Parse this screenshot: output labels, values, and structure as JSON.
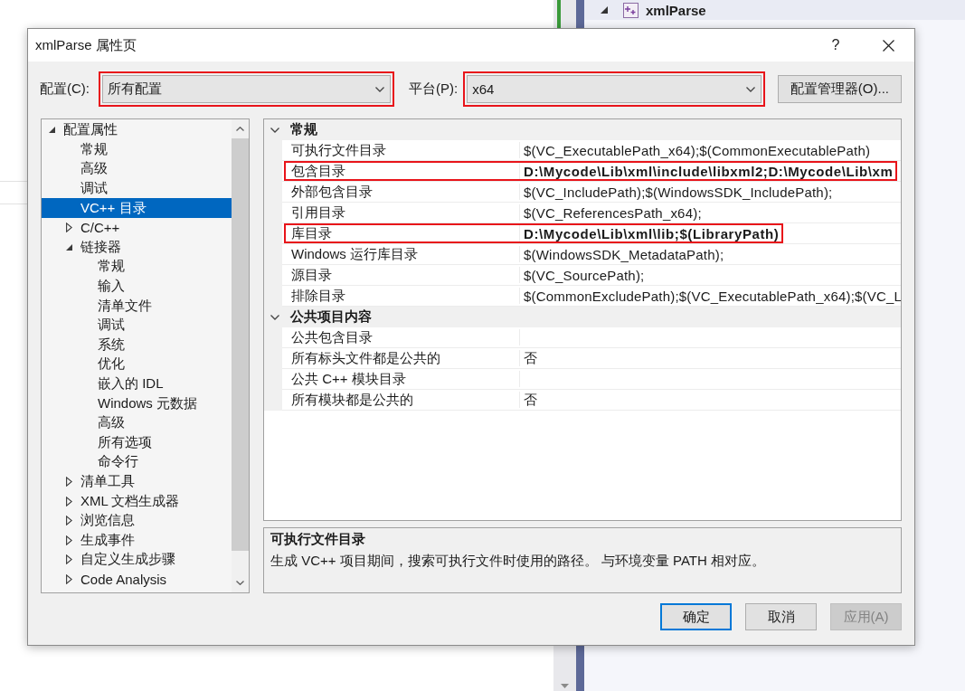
{
  "background": {
    "solution_explorer": {
      "items": [
        {
          "label": "xmlParse",
          "expanded": true
        }
      ]
    }
  },
  "dialog": {
    "title": "xmlParse 属性页",
    "help_button": "?"
  },
  "config_bar": {
    "configuration": {
      "label": "配置(C):",
      "value": "所有配置",
      "highlighted": true
    },
    "platform": {
      "label": "平台(P):",
      "value": "x64",
      "highlighted": true
    },
    "manager_button": "配置管理器(O)..."
  },
  "tree": [
    {
      "label": "配置属性",
      "kind": "group",
      "expanded": true,
      "selected": false,
      "children": [
        {
          "label": "常规",
          "kind": "page",
          "selected": false
        },
        {
          "label": "高级",
          "kind": "page",
          "selected": false
        },
        {
          "label": "调试",
          "kind": "page",
          "selected": false
        },
        {
          "label": "VC++ 目录",
          "kind": "page",
          "selected": true
        },
        {
          "label": "C/C++",
          "kind": "group",
          "expanded": false,
          "selected": false
        },
        {
          "label": "链接器",
          "kind": "group",
          "expanded": true,
          "selected": false,
          "children": [
            {
              "label": "常规",
              "kind": "page",
              "selected": false
            },
            {
              "label": "输入",
              "kind": "page",
              "selected": false
            },
            {
              "label": "清单文件",
              "kind": "page",
              "selected": false
            },
            {
              "label": "调试",
              "kind": "page",
              "selected": false
            },
            {
              "label": "系统",
              "kind": "page",
              "selected": false
            },
            {
              "label": "优化",
              "kind": "page",
              "selected": false
            },
            {
              "label": "嵌入的 IDL",
              "kind": "page",
              "selected": false
            },
            {
              "label": "Windows 元数据",
              "kind": "page",
              "selected": false
            },
            {
              "label": "高级",
              "kind": "page",
              "selected": false
            },
            {
              "label": "所有选项",
              "kind": "page",
              "selected": false
            },
            {
              "label": "命令行",
              "kind": "page",
              "selected": false
            }
          ]
        },
        {
          "label": "清单工具",
          "kind": "group",
          "expanded": false,
          "selected": false
        },
        {
          "label": "XML 文档生成器",
          "kind": "group",
          "expanded": false,
          "selected": false
        },
        {
          "label": "浏览信息",
          "kind": "group",
          "expanded": false,
          "selected": false
        },
        {
          "label": "生成事件",
          "kind": "group",
          "expanded": false,
          "selected": false
        },
        {
          "label": "自定义生成步骤",
          "kind": "group",
          "expanded": false,
          "selected": false
        },
        {
          "label": "Code Analysis",
          "kind": "group",
          "expanded": false,
          "selected": false
        }
      ]
    }
  ],
  "property_grid": {
    "sections": [
      {
        "title": "常规",
        "expanded": true,
        "rows": [
          {
            "name": "可执行文件目录",
            "value": "$(VC_ExecutablePath_x64);$(CommonExecutablePath)",
            "modified": false,
            "highlighted": false
          },
          {
            "name": "包含目录",
            "value": "D:\\Mycode\\Lib\\xml\\include\\libxml2;D:\\Mycode\\Lib\\xm",
            "modified": true,
            "highlighted": true
          },
          {
            "name": "外部包含目录",
            "value": "$(VC_IncludePath);$(WindowsSDK_IncludePath);",
            "modified": false,
            "highlighted": false
          },
          {
            "name": "引用目录",
            "value": "$(VC_ReferencesPath_x64);",
            "modified": false,
            "highlighted": false
          },
          {
            "name": "库目录",
            "value": "D:\\Mycode\\Lib\\xml\\lib;$(LibraryPath)",
            "modified": true,
            "highlighted": true
          },
          {
            "name": "Windows 运行库目录",
            "value": "$(WindowsSDK_MetadataPath);",
            "modified": false,
            "highlighted": false
          },
          {
            "name": "源目录",
            "value": "$(VC_SourcePath);",
            "modified": false,
            "highlighted": false
          },
          {
            "name": "排除目录",
            "value": "$(CommonExcludePath);$(VC_ExecutablePath_x64);$(VC_L",
            "modified": false,
            "highlighted": false
          }
        ]
      },
      {
        "title": "公共项目内容",
        "expanded": true,
        "rows": [
          {
            "name": "公共包含目录",
            "highlighted": false
          },
          {
            "name": "所有标头文件都是公共的",
            "value": "否",
            "modified": false,
            "highlighted": false
          },
          {
            "name": "公共 C++ 模块目录",
            "highlighted": false
          },
          {
            "name": "所有模块都是公共的",
            "value": "否",
            "modified": false,
            "highlighted": false
          }
        ]
      }
    ]
  },
  "description": {
    "title": "可执行文件目录",
    "text": "生成 VC++ 项目期间，搜索可执行文件时使用的路径。 与环境变量 PATH 相对应。"
  },
  "buttons": [
    {
      "label": "确定",
      "default": true,
      "disabled": false
    },
    {
      "label": "取消",
      "default": false,
      "disabled": false
    },
    {
      "label": "应用(A)",
      "default": false,
      "disabled": true
    }
  ]
}
